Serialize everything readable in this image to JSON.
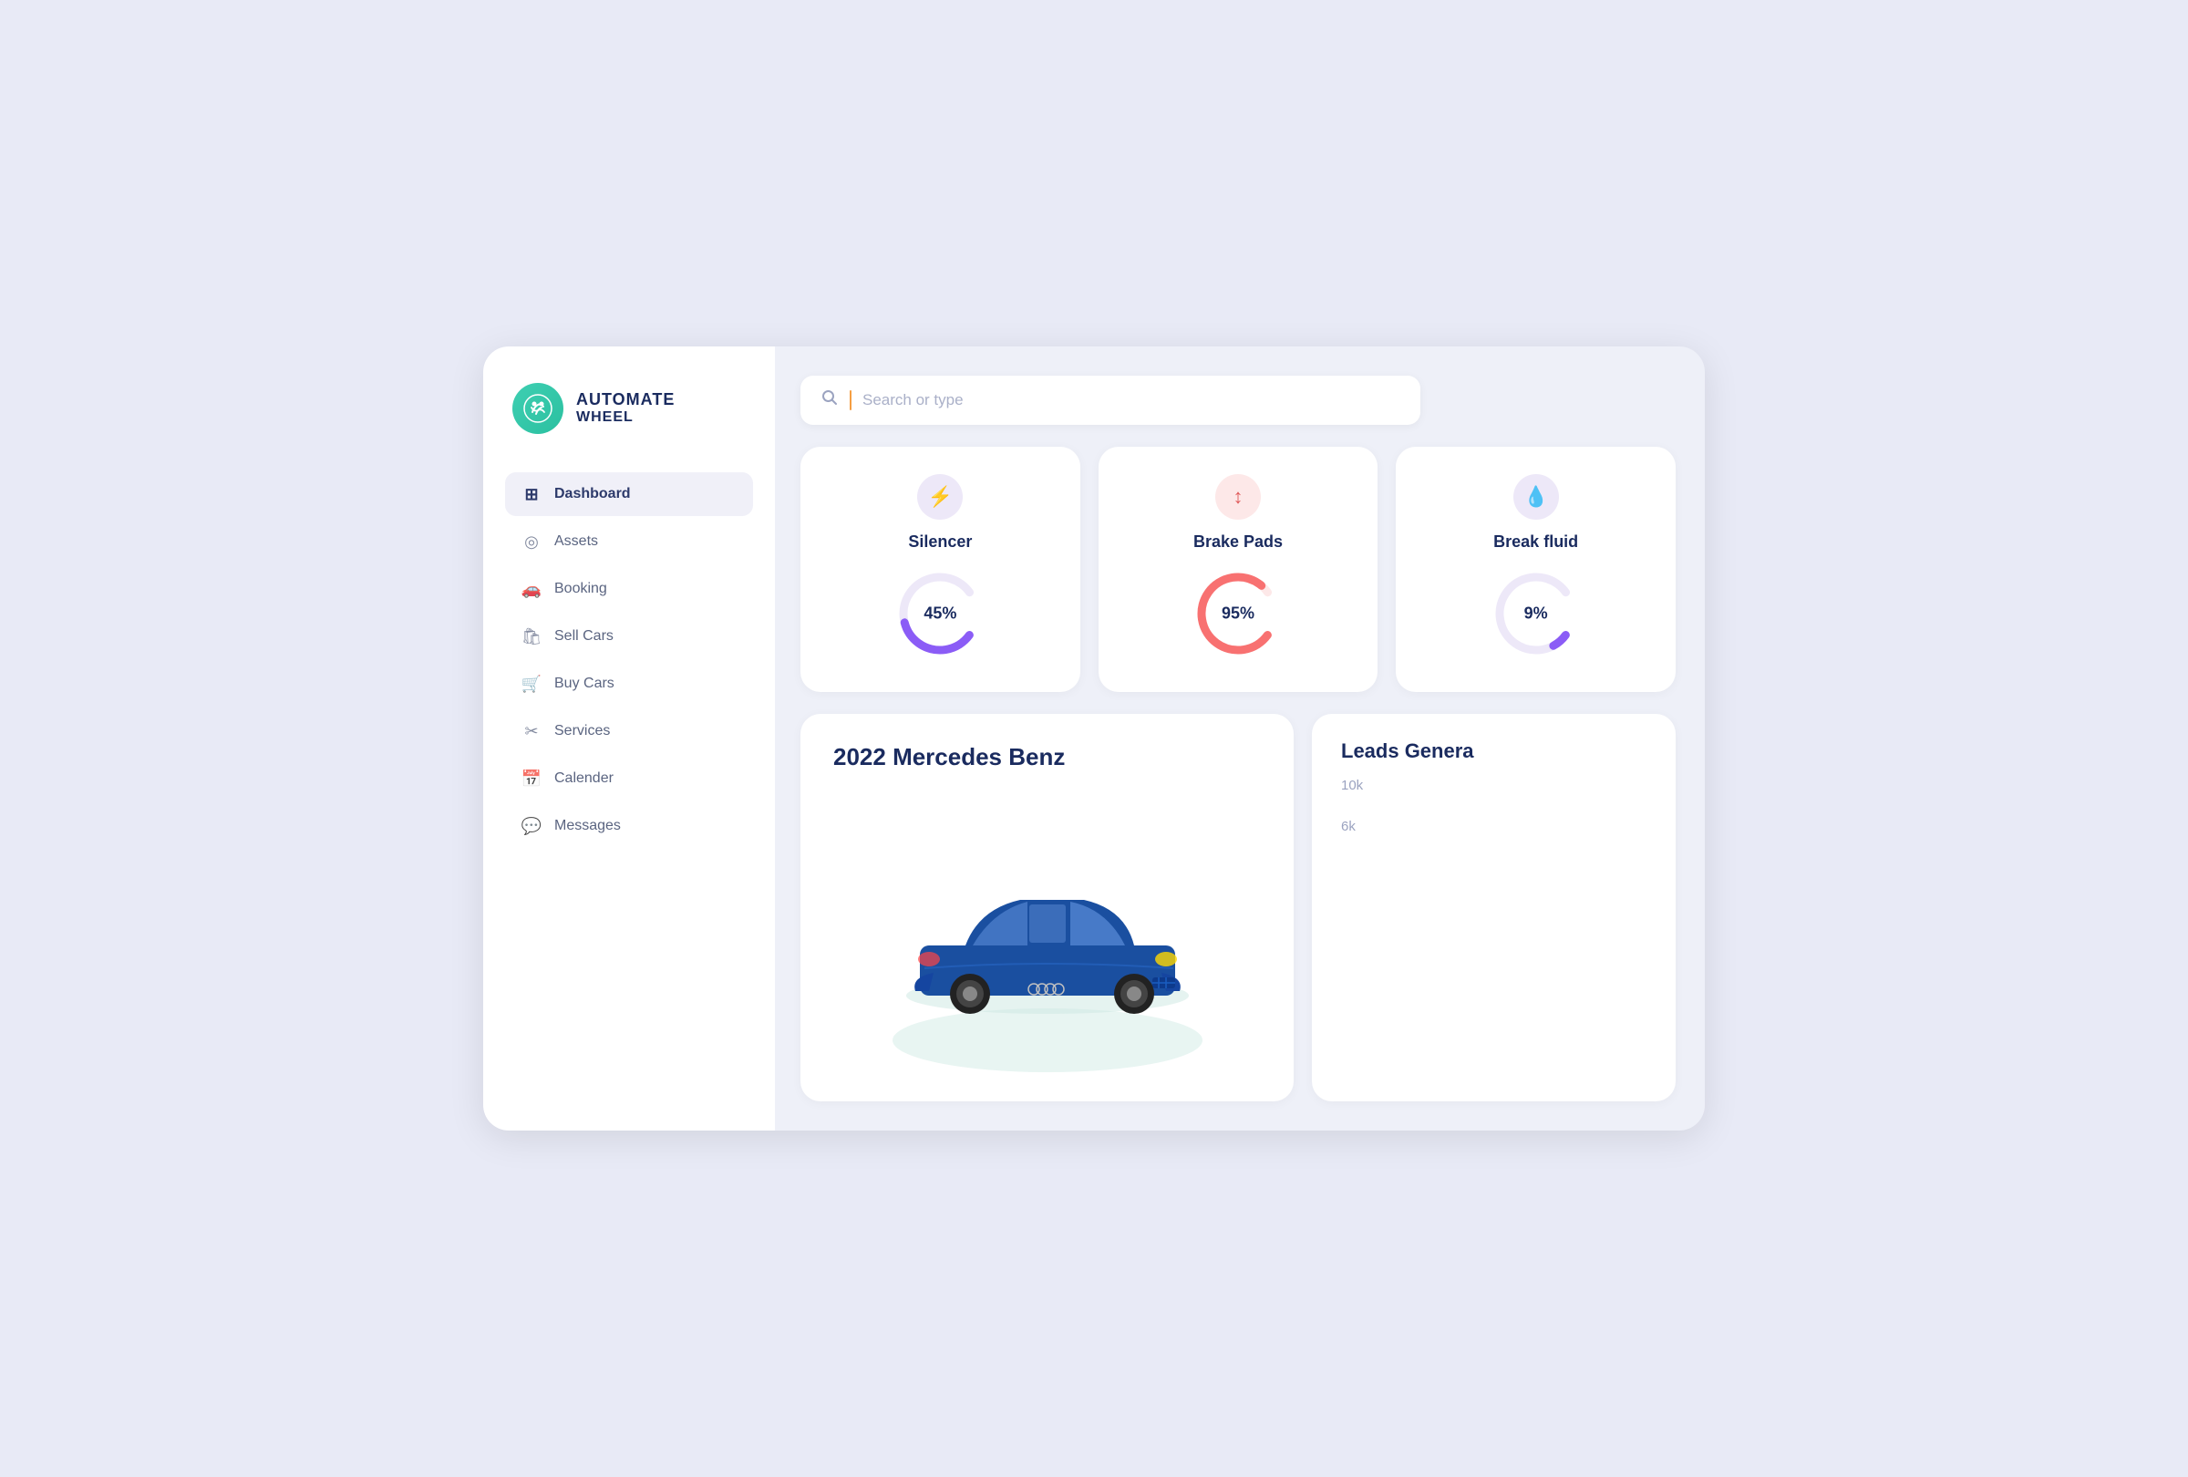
{
  "app": {
    "title": "AUTOMATE",
    "subtitle": "WHEEL"
  },
  "nav": {
    "items": [
      {
        "id": "dashboard",
        "label": "Dashboard",
        "icon": "⊞",
        "active": true
      },
      {
        "id": "assets",
        "label": "Assets",
        "icon": "◎",
        "active": false
      },
      {
        "id": "booking",
        "label": "Booking",
        "icon": "🚗",
        "active": false
      },
      {
        "id": "sell-cars",
        "label": "Sell Cars",
        "icon": "🛍",
        "active": false
      },
      {
        "id": "buy-cars",
        "label": "Buy Cars",
        "icon": "🛒",
        "active": false
      },
      {
        "id": "services",
        "label": "Services",
        "icon": "✂",
        "active": false
      },
      {
        "id": "calender",
        "label": "Calender",
        "icon": "📅",
        "active": false
      },
      {
        "id": "messages",
        "label": "Messages",
        "icon": "💬",
        "active": false
      }
    ]
  },
  "search": {
    "placeholder": "Search or type"
  },
  "metrics": [
    {
      "id": "silencer",
      "title": "Silencer",
      "percent": 45,
      "icon": "⚡",
      "iconStyle": "purple",
      "color": "#8b5cf6",
      "trackColor": "#ede8f8"
    },
    {
      "id": "brake-pads",
      "title": "Brake Pads",
      "percent": 95,
      "icon": "↕",
      "iconStyle": "pink",
      "color": "#f87171",
      "trackColor": "#fde8e8"
    },
    {
      "id": "break-fluid",
      "title": "Break fluid",
      "percent": 9,
      "icon": "💧",
      "iconStyle": "lavender",
      "color": "#8b5cf6",
      "trackColor": "#ede8f8"
    }
  ],
  "carCard": {
    "title": "2022 Mercedes Benz"
  },
  "leadsCard": {
    "title": "Leads Genera",
    "yAxisValues": [
      "10k",
      "6k"
    ]
  }
}
